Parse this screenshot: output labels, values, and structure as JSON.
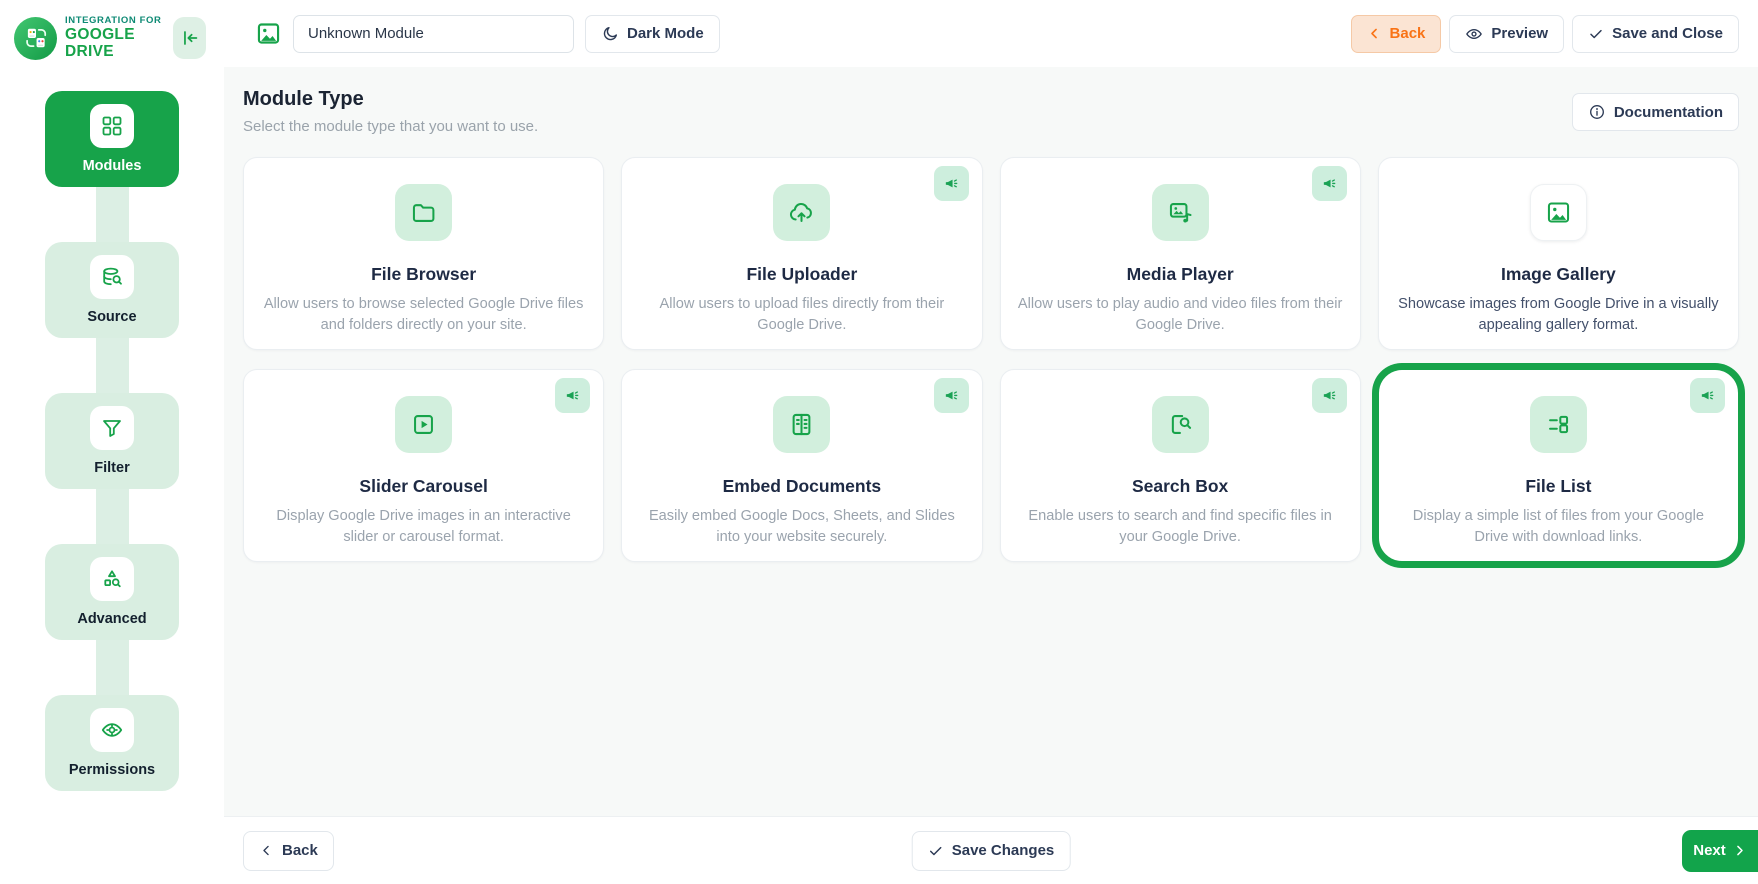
{
  "brand": {
    "line1": "INTEGRATION FOR",
    "line2": "GOOGLE DRIVE"
  },
  "sidebar": {
    "items": [
      {
        "id": "modules",
        "label": "Modules",
        "icon": "grid",
        "active": true
      },
      {
        "id": "source",
        "label": "Source",
        "icon": "database-search",
        "active": false
      },
      {
        "id": "filter",
        "label": "Filter",
        "icon": "funnel",
        "active": false
      },
      {
        "id": "advanced",
        "label": "Advanced",
        "icon": "shapes-search",
        "active": false
      },
      {
        "id": "permissions",
        "label": "Permissions",
        "icon": "eye-gear",
        "active": false
      }
    ]
  },
  "topbar": {
    "module_name_value": "Unknown Module",
    "dark_mode_label": "Dark Mode",
    "back_label": "Back",
    "preview_label": "Preview",
    "save_close_label": "Save and Close"
  },
  "main": {
    "title": "Module Type",
    "subtitle": "Select the module type that you want to use.",
    "documentation_label": "Documentation",
    "cards": [
      {
        "id": "file-browser",
        "title": "File Browser",
        "description": "Allow users to browse selected Google Drive files and folders directly on your site.",
        "icon": "folder",
        "badge": false,
        "selected": false,
        "tile": "green",
        "desc_dark": false
      },
      {
        "id": "file-uploader",
        "title": "File Uploader",
        "description": "Allow users to upload files directly from their Google Drive.",
        "icon": "cloud-upload",
        "badge": true,
        "selected": false,
        "tile": "green",
        "desc_dark": false
      },
      {
        "id": "media-player",
        "title": "Media Player",
        "description": "Allow users to play audio and video files from their Google Drive.",
        "icon": "media-player",
        "badge": true,
        "selected": false,
        "tile": "green",
        "desc_dark": false
      },
      {
        "id": "image-gallery",
        "title": "Image Gallery",
        "description": "Showcase images from Google Drive in a visually appealing gallery format.",
        "icon": "image",
        "badge": false,
        "selected": false,
        "tile": "white",
        "desc_dark": true
      },
      {
        "id": "slider-carousel",
        "title": "Slider Carousel",
        "description": "Display Google Drive images in an interactive slider or carousel format.",
        "icon": "slider-play",
        "badge": true,
        "selected": false,
        "tile": "green",
        "desc_dark": false
      },
      {
        "id": "embed-documents",
        "title": "Embed Documents",
        "description": "Easily embed Google Docs, Sheets, and Slides into your website securely.",
        "icon": "embed-doc",
        "badge": true,
        "selected": false,
        "tile": "green",
        "desc_dark": false
      },
      {
        "id": "search-box",
        "title": "Search Box",
        "description": "Enable users to search and find specific files in your Google Drive.",
        "icon": "doc-search",
        "badge": true,
        "selected": false,
        "tile": "green",
        "desc_dark": false
      },
      {
        "id": "file-list",
        "title": "File List",
        "description": "Display a simple list of files from your Google Drive with download links.",
        "icon": "file-list",
        "badge": true,
        "selected": true,
        "tile": "green",
        "desc_dark": false
      }
    ]
  },
  "footer": {
    "back_label": "Back",
    "save_label": "Save Changes",
    "next_label": "Next"
  },
  "colors": {
    "accent_green": "#17a34a",
    "sidebar_item_green": "#d9eee1",
    "tile_green": "#d2efdd",
    "badge_green": "#cdeedd",
    "orange": "#f97316",
    "orange_bg": "#fbe4d3",
    "dark_text": "#1e2a44",
    "gray_text": "#9aa3ad",
    "content_bg": "#f7f9f8"
  }
}
